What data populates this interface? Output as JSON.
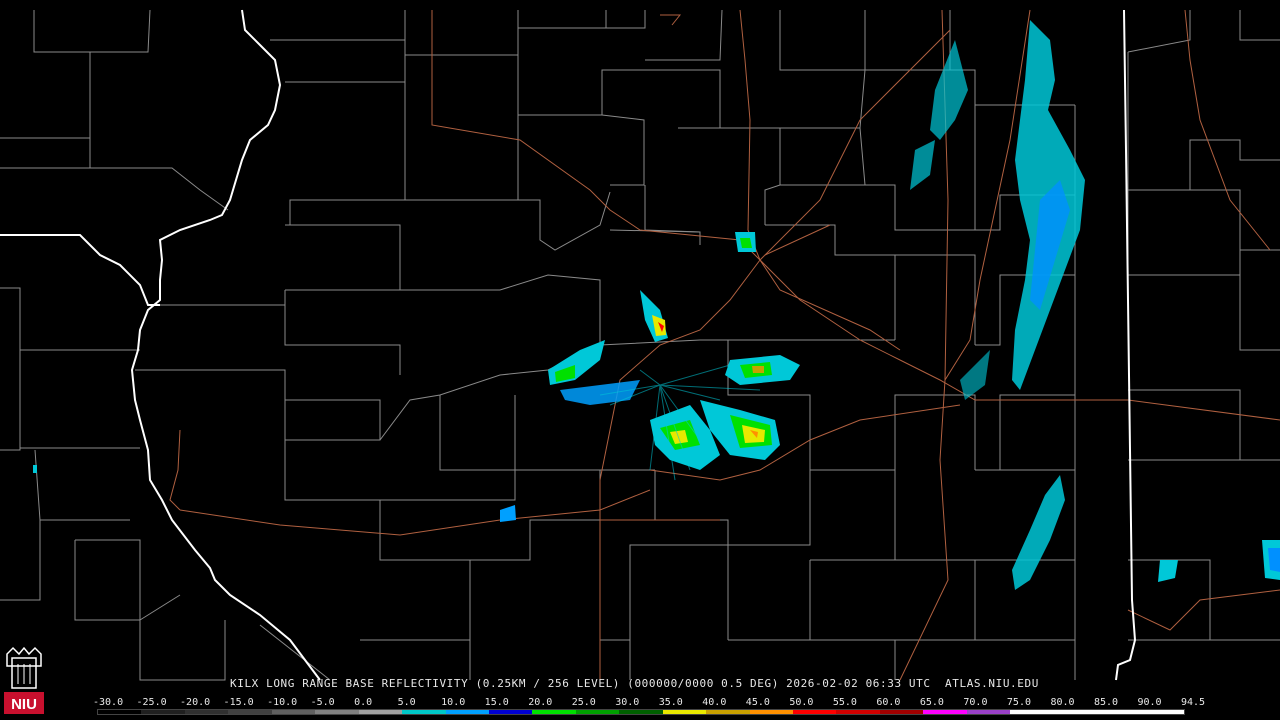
{
  "product_title": "KILX LONG RANGE BASE REFLECTIVITY (0.25KM / 256 LEVEL) (000000/0000 0.5 DEG) 2026-02-02 06:33 UTC  ATLAS.NIU.EDU",
  "logo": {
    "text": "NIU",
    "color": "#c8102e"
  },
  "legend": {
    "labels": [
      "-30.0",
      "-25.0",
      "-20.0",
      "-15.0",
      "-10.0",
      "-5.0",
      "0.0",
      "5.0",
      "10.0",
      "15.0",
      "20.0",
      "25.0",
      "30.0",
      "35.0",
      "40.0",
      "45.0",
      "50.0",
      "55.0",
      "60.0",
      "65.0",
      "70.0",
      "75.0",
      "80.0",
      "85.0",
      "90.0",
      "94.5"
    ],
    "colors": [
      "#000000",
      "#202020",
      "#303030",
      "#404040",
      "#606060",
      "#808080",
      "#a0a0a0",
      "#00c8c8",
      "#00a0ff",
      "#0000d0",
      "#00e000",
      "#00a000",
      "#006000",
      "#e8e800",
      "#c8a000",
      "#ff9000",
      "#ff0000",
      "#d00000",
      "#a00000",
      "#ff00ff",
      "#9a40c8",
      "#ffffff",
      "#ffffff",
      "#ffffff",
      "#ffffff"
    ]
  },
  "map_colors": {
    "background": "#000000",
    "county_lines": "#8a8a8a",
    "state_lines": "#ffffff",
    "highways": "#b06040"
  }
}
